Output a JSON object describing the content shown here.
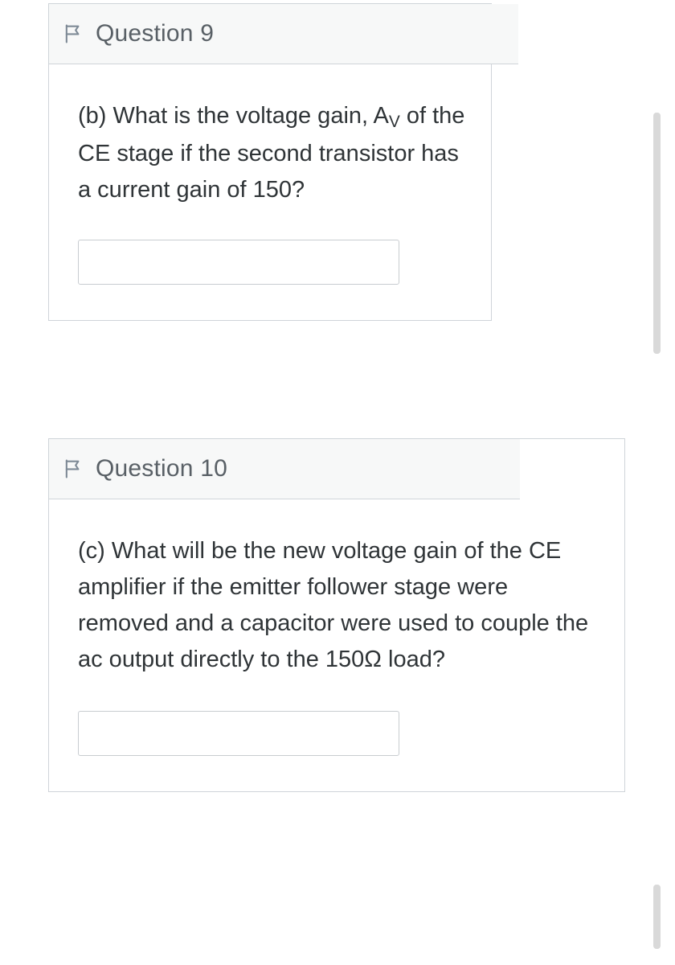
{
  "questions": [
    {
      "id": "q9",
      "header": "Question 9",
      "prompt_before": "(b) What is the voltage gain, A",
      "prompt_sub": "V",
      "prompt_after": " of the CE stage if the second transistor has a current gain of 150?",
      "answer": ""
    },
    {
      "id": "q10",
      "header": "Question 10",
      "prompt_before": "(c)  What will be the new voltage gain of the CE amplifier if the emitter follower stage were removed and a capacitor were used to couple the ac output directly to the 150Ω load?",
      "prompt_sub": "",
      "prompt_after": "",
      "answer": ""
    }
  ]
}
